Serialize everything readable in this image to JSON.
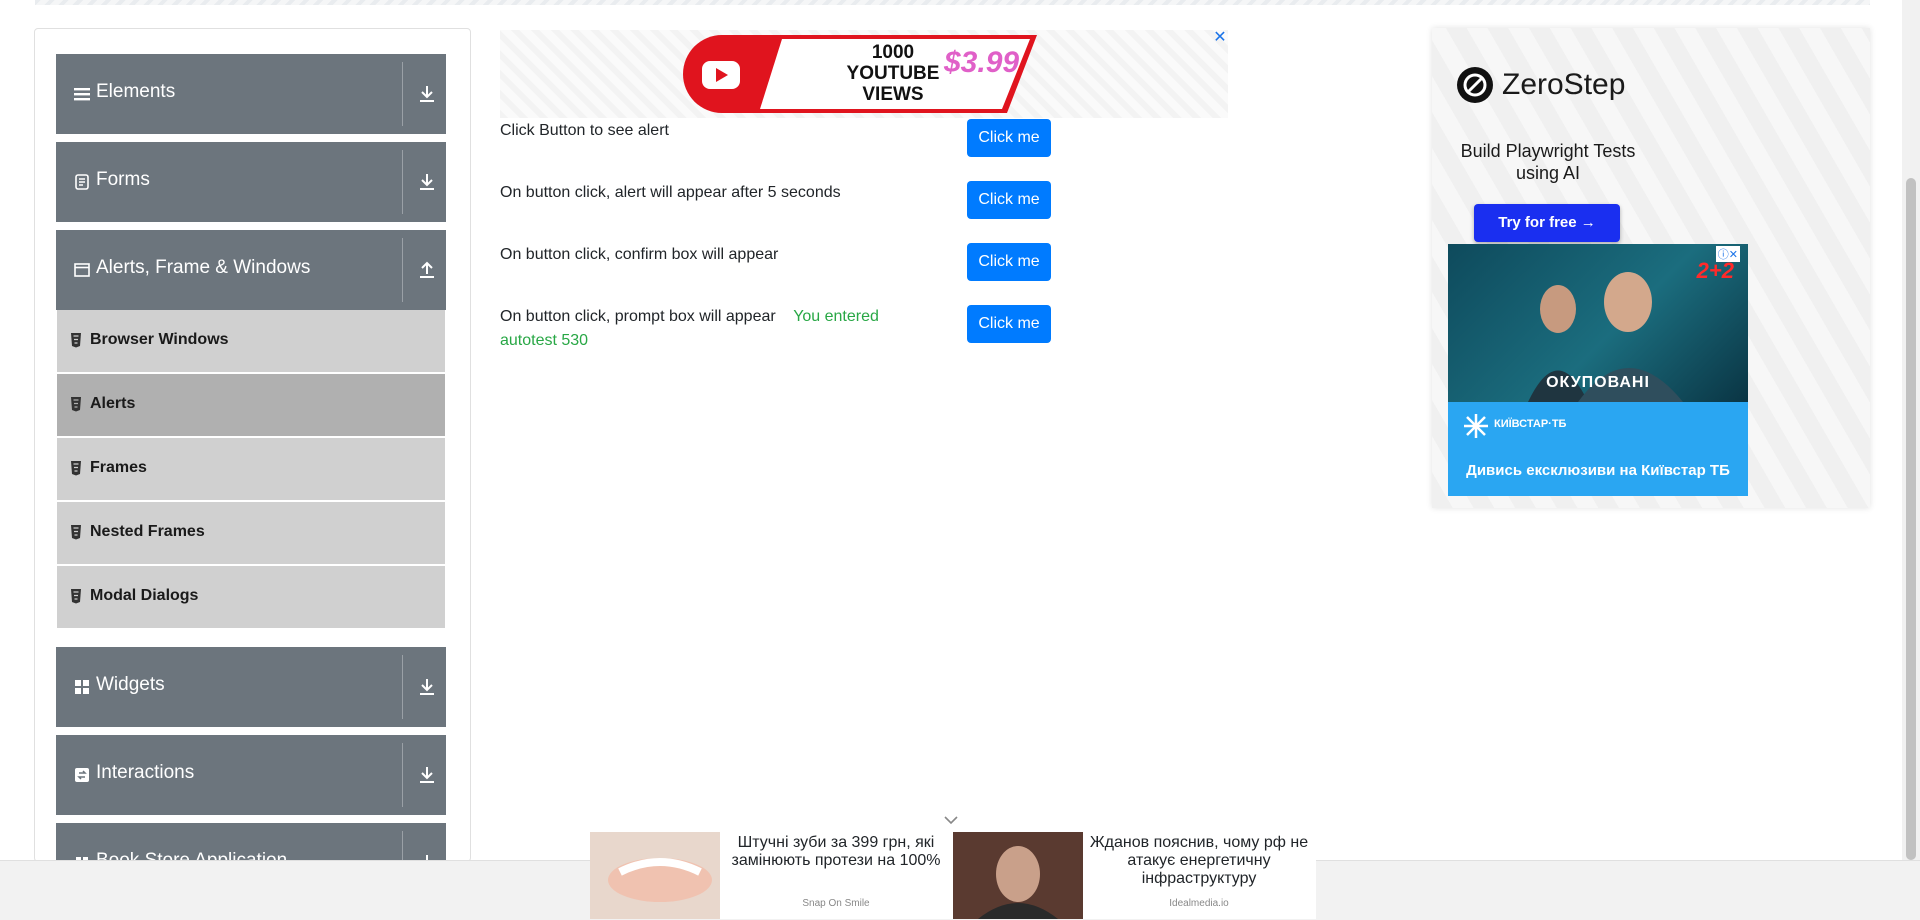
{
  "sidebar": {
    "groups": [
      {
        "title": "Elements",
        "icon": "hamburger-icon",
        "arrow": "download-arrow-icon"
      },
      {
        "title": "Forms",
        "icon": "form-icon",
        "arrow": "download-arrow-icon"
      },
      {
        "title": "Alerts, Frame & Windows",
        "icon": "window-icon",
        "arrow": "upload-arrow-icon"
      },
      {
        "title": "Widgets",
        "icon": "widgets-grid-icon",
        "arrow": "download-arrow-icon"
      },
      {
        "title": "Interactions",
        "icon": "interactions-icon",
        "arrow": "download-arrow-icon"
      },
      {
        "title": "Book Store Application",
        "icon": "book-icon",
        "arrow": "download-arrow-icon"
      }
    ],
    "alerts_items": [
      {
        "label": "Browser Windows",
        "active": false
      },
      {
        "label": "Alerts",
        "active": true
      },
      {
        "label": "Frames",
        "active": false
      },
      {
        "label": "Nested Frames",
        "active": false
      },
      {
        "label": "Modal Dialogs",
        "active": false
      }
    ]
  },
  "ad_top": {
    "views_line1": "1000",
    "views_line2": "YOUTUBE VIEWS",
    "price": "$3.99",
    "close_label": "✕"
  },
  "alerts": {
    "rows": [
      {
        "label": "Click Button to see alert",
        "button": "Click me"
      },
      {
        "label": "On button click, alert will appear after 5 seconds",
        "button": "Click me"
      },
      {
        "label": "On button click, confirm box will appear",
        "button": "Click me"
      },
      {
        "label": "On button click, prompt box will appear",
        "button": "Click me",
        "result": "You entered autotest 530"
      }
    ]
  },
  "right_ad": {
    "brand": "ZeroStep",
    "tagline": "Build Playwright Tests using AI",
    "cta": "Try for free →",
    "kyiv": {
      "badge": "ⓘ✕",
      "channel": "2+2",
      "title": "ОКУПОВАНІ",
      "brand": "КИЇВСТАР·ТБ",
      "cta": "Дивись ексклюзиви на Київстар ТБ"
    }
  },
  "bottom_ad": [
    {
      "headline": "Штучні зуби за 399 грн, які замінюють протези на 100%",
      "source": "Snap On Smile"
    },
    {
      "headline": "Жданов пояснив, чому рф не атакує енергетичну інфраструктуру",
      "source": "Idealmedia.io"
    }
  ],
  "colors": {
    "group_bg": "#6c757d",
    "sub_bg": "#d0d0d0",
    "sub_active_bg": "#b0b0b0",
    "primary": "#007bff",
    "success": "#28a745"
  }
}
